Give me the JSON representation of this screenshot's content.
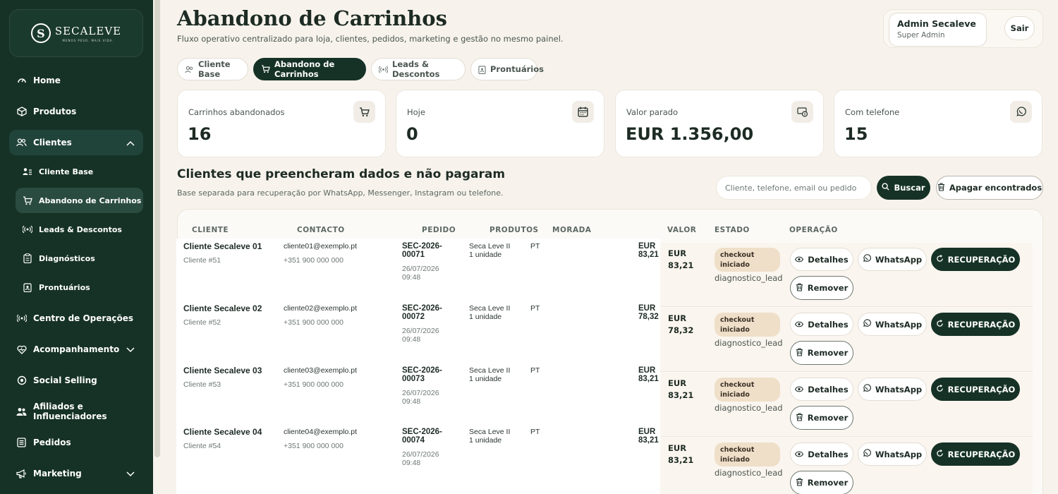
{
  "brand": {
    "name": "SECALEVE",
    "tagline": "MENOS PESO. MAIS VIDA.",
    "mark": "S"
  },
  "sidebar": {
    "items": [
      {
        "label": "Home",
        "icon": "dashboard-icon"
      },
      {
        "label": "Produtos",
        "icon": "box-icon"
      },
      {
        "label": "Clientes",
        "icon": "users-icon",
        "open": true
      },
      {
        "label": "Centro de Operações",
        "icon": "broadcast-icon"
      },
      {
        "label": "Acompanhamento",
        "icon": "heart-pulse-icon"
      },
      {
        "label": "Social Selling",
        "icon": "target-icon"
      },
      {
        "label": "Afiliados e Influenciadores",
        "icon": "group-icon"
      },
      {
        "label": "Pedidos",
        "icon": "list-icon"
      },
      {
        "label": "Marketing",
        "icon": "megaphone-icon"
      }
    ],
    "subitems": [
      {
        "label": "Cliente Base",
        "icon": "user-list-icon"
      },
      {
        "label": "Abandono de Carrinhos",
        "icon": "cart-icon",
        "active": true
      },
      {
        "label": "Leads & Descontos",
        "icon": "broadcast-icon"
      },
      {
        "label": "Diagnósticos",
        "icon": "clipboard-icon"
      },
      {
        "label": "Prontuários",
        "icon": "clipboard-user-icon"
      }
    ]
  },
  "header": {
    "title": "Abandono de Carrinhos",
    "subtitle": "Fluxo operativo centralizado para loja, clientes, pedidos, marketing e gestão no mesmo painel.",
    "user_name": "Admin Secaleve",
    "user_role": "Super Admin",
    "logout": "Sair"
  },
  "tabs": [
    {
      "label": "Cliente Base"
    },
    {
      "label": "Abandono de Carrinhos",
      "active": true
    },
    {
      "label": "Leads & Descontos"
    },
    {
      "label": "Prontuários"
    }
  ],
  "stats": [
    {
      "label": "Carrinhos abandonados",
      "value": "16",
      "icon": "cart-icon"
    },
    {
      "label": "Hoje",
      "value": "0",
      "icon": "calendar-icon"
    },
    {
      "label": "Valor parado",
      "value": "EUR 1.356,00",
      "icon": "money-icon"
    },
    {
      "label": "Com telefone",
      "value": "15",
      "icon": "whatsapp-icon"
    }
  ],
  "section": {
    "title": "Clientes que preencheram dados e não pagaram",
    "subtitle": "Base separada para recuperação por WhatsApp, Messenger, Instagram ou telefone.",
    "search_placeholder": "Cliente, telefone, email ou pedido",
    "search_button": "Buscar",
    "delete_button": "Apagar encontrados"
  },
  "table": {
    "columns": [
      "CLIENTE",
      "CONTACTO",
      "PEDIDO",
      "PRODUTOS",
      "MORADA",
      "VALOR",
      "ESTADO",
      "OPERAÇÃO"
    ],
    "actions": {
      "details": "Detalhes",
      "whatsapp": "WhatsApp",
      "recovery": "RECUPERAÇÃO",
      "remove": "Remover"
    },
    "rows": [
      {
        "name": "Cliente Secaleve 01",
        "id": "Cliente #51",
        "email": "cliente01@exemplo.pt",
        "phone": "+351 900 000 000",
        "order_a": "SEC-2026-",
        "order_b": "00071",
        "date": "26/07/2026",
        "time": "09:48",
        "product": "Seca Leve II",
        "qty": "1 unidade",
        "address": "PT",
        "cur": "EUR",
        "amount": "83,21",
        "value_line1": "EUR",
        "value_line2": "83,21",
        "status_a": "checkout",
        "status_b": "iniciado",
        "source": "diagnostico_lead"
      },
      {
        "name": "Cliente Secaleve 02",
        "id": "Cliente #52",
        "email": "cliente02@exemplo.pt",
        "phone": "+351 900 000 000",
        "order_a": "SEC-2026-",
        "order_b": "00072",
        "date": "26/07/2026",
        "time": "09:48",
        "product": "Seca Leve II",
        "qty": "1 unidade",
        "address": "PT",
        "cur": "EUR",
        "amount": "78,32",
        "value_line1": "EUR",
        "value_line2": "78,32",
        "status_a": "checkout",
        "status_b": "iniciado",
        "source": "diagnostico_lead"
      },
      {
        "name": "Cliente Secaleve 03",
        "id": "Cliente #53",
        "email": "cliente03@exemplo.pt",
        "phone": "+351 900 000 000",
        "order_a": "SEC-2026-",
        "order_b": "00073",
        "date": "26/07/2026",
        "time": "09:48",
        "product": "Seca Leve II",
        "qty": "1 unidade",
        "address": "PT",
        "cur": "EUR",
        "amount": "83,21",
        "value_line1": "EUR",
        "value_line2": "83,21",
        "status_a": "checkout",
        "status_b": "iniciado",
        "source": "diagnostico_lead"
      },
      {
        "name": "Cliente Secaleve 04",
        "id": "Cliente #54",
        "email": "cliente04@exemplo.pt",
        "phone": "+351 900 000 000",
        "order_a": "SEC-2026-",
        "order_b": "00074",
        "date": "26/07/2026",
        "time": "09:48",
        "product": "Seca Leve II",
        "qty": "1 unidade",
        "address": "PT",
        "cur": "EUR",
        "amount": "83,21",
        "value_line1": "EUR",
        "value_line2": "83,21",
        "status_a": "checkout",
        "status_b": "iniciado",
        "source": "diagnostico_lead"
      }
    ]
  }
}
